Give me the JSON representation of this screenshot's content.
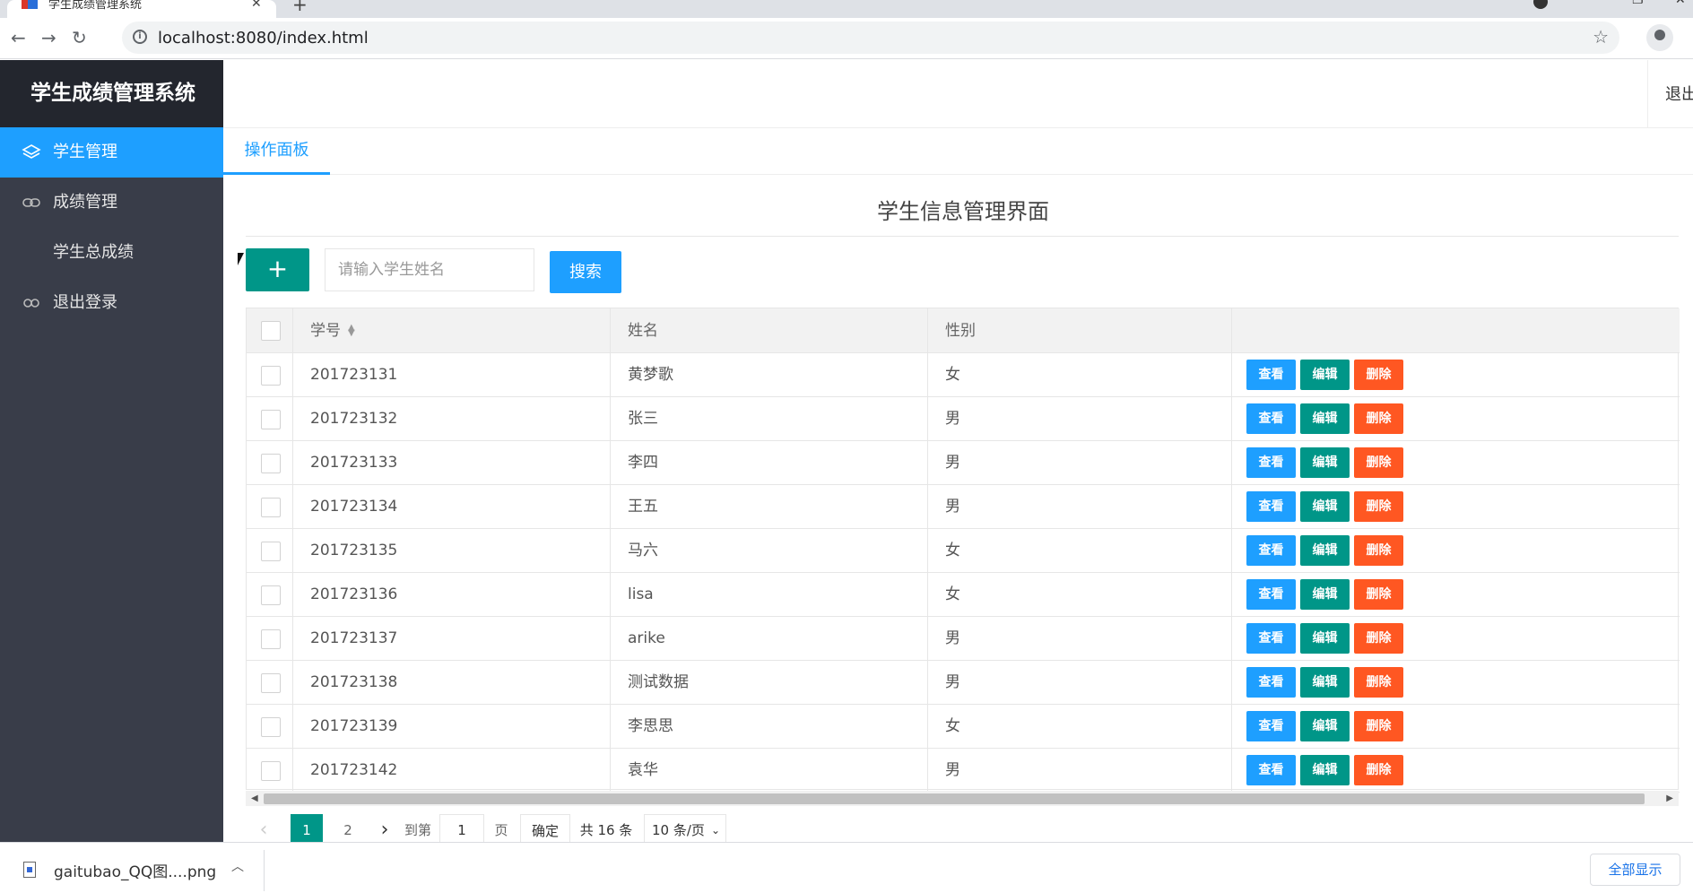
{
  "browser": {
    "tab_title": "学生成绩管理系统",
    "url": "localhost:8080/index.html"
  },
  "sidebar": {
    "brand": "学生成绩管理系统",
    "items": [
      {
        "label": "学生管理",
        "icon": "layers-icon",
        "active": true
      },
      {
        "label": "成绩管理",
        "icon": "link-icon",
        "active": false
      },
      {
        "label": "学生总成绩",
        "icon": "",
        "active": false
      },
      {
        "label": "退出登录",
        "icon": "loop-icon",
        "active": false
      }
    ]
  },
  "header": {
    "logout": "退出"
  },
  "tabs": [
    {
      "label": "操作面板"
    }
  ],
  "main": {
    "title": "学生信息管理界面",
    "add_label": "+",
    "search_placeholder": "请输入学生姓名",
    "search_label": "搜索"
  },
  "table": {
    "columns": [
      "学号",
      "姓名",
      "性别"
    ],
    "actions": {
      "view": "查看",
      "edit": "编辑",
      "delete": "删除"
    },
    "rows": [
      {
        "id": "201723131",
        "name": "黄梦歌",
        "gender": "女"
      },
      {
        "id": "201723132",
        "name": "张三",
        "gender": "男"
      },
      {
        "id": "201723133",
        "name": "李四",
        "gender": "男"
      },
      {
        "id": "201723134",
        "name": "王五",
        "gender": "男"
      },
      {
        "id": "201723135",
        "name": "马六",
        "gender": "女"
      },
      {
        "id": "201723136",
        "name": "lisa",
        "gender": "女"
      },
      {
        "id": "201723137",
        "name": "arike",
        "gender": "男"
      },
      {
        "id": "201723138",
        "name": "测试数据",
        "gender": "男"
      },
      {
        "id": "201723139",
        "name": "李思思",
        "gender": "女"
      },
      {
        "id": "201723142",
        "name": "袁华",
        "gender": "男"
      }
    ]
  },
  "pager": {
    "prev": "‹",
    "pages": [
      "1",
      "2"
    ],
    "current": "1",
    "next": "›",
    "goto_label": "到第",
    "goto_value": "1",
    "page_unit": "页",
    "confirm": "确定",
    "total": "共 16 条",
    "page_size": "10 条/页"
  },
  "downloads": {
    "file_name": "gaitubao_QQ图....png",
    "show_all": "全部显示"
  },
  "colors": {
    "primary": "#1e9fff",
    "teal": "#009688",
    "danger": "#ff5722",
    "sidebar": "#393d49",
    "brand_bg": "#23262e"
  }
}
